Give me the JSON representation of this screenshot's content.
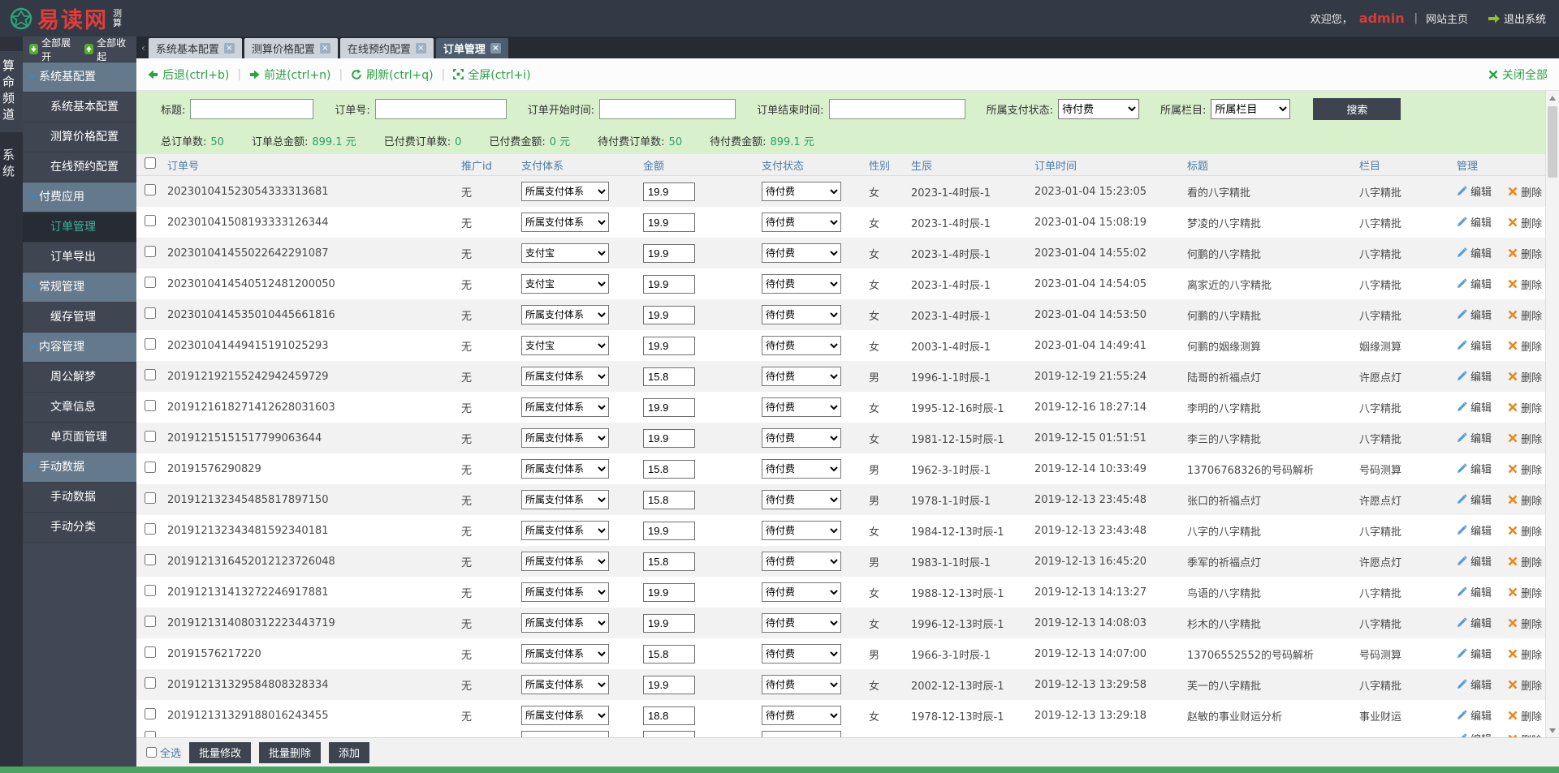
{
  "topbar": {
    "logo_text": "易读网",
    "logo_sub": "测算",
    "welcome_prefix": "欢迎您，",
    "username": "admin",
    "separator": "|",
    "home_link": "网站主页",
    "logout": "退出系统"
  },
  "rail": {
    "items": [
      {
        "label": "算命频道",
        "active": true
      },
      {
        "label": "系统",
        "active": false
      }
    ]
  },
  "sidebar": {
    "expand_all": "全部展开",
    "collapse_all": "全部收起",
    "groups": [
      {
        "label": "系统基配置",
        "items": [
          {
            "label": "系统基本配置",
            "active": false
          },
          {
            "label": "测算价格配置",
            "active": false
          },
          {
            "label": "在线预约配置",
            "active": false
          }
        ]
      },
      {
        "label": "付费应用",
        "items": [
          {
            "label": "订单管理",
            "active": true
          },
          {
            "label": "订单导出",
            "active": false
          }
        ]
      },
      {
        "label": "常规管理",
        "items": [
          {
            "label": "缓存管理",
            "active": false
          }
        ]
      },
      {
        "label": "内容管理",
        "items": [
          {
            "label": "周公解梦",
            "active": false
          },
          {
            "label": "文章信息",
            "active": false
          },
          {
            "label": "单页面管理",
            "active": false
          }
        ]
      },
      {
        "label": "手动数据",
        "items": [
          {
            "label": "手动数据",
            "active": false
          },
          {
            "label": "手动分类",
            "active": false
          }
        ]
      }
    ]
  },
  "tabs": [
    {
      "label": "系统基本配置",
      "active": false
    },
    {
      "label": "测算价格配置",
      "active": false
    },
    {
      "label": "在线预约配置",
      "active": false
    },
    {
      "label": "订单管理",
      "active": true
    }
  ],
  "toolbar": {
    "back": "后退(ctrl+b)",
    "forward": "前进(ctrl+n)",
    "refresh": "刷新(ctrl+q)",
    "fullscreen": "全屏(ctrl+i)",
    "close_all": "关闭全部",
    "separator": "|"
  },
  "filters": {
    "title_label": "标题:",
    "order_no_label": "订单号:",
    "start_time_label": "订单开始时间:",
    "end_time_label": "订单结束时间:",
    "pay_status_label": "所属支付状态:",
    "pay_status_value": "待付费",
    "category_label": "所属栏目:",
    "category_value": "所属栏目",
    "search_button": "搜索"
  },
  "summary": [
    {
      "label": "总订单数:",
      "value": "50"
    },
    {
      "label": "订单总金额:",
      "value": "899.1 元"
    },
    {
      "label": "已付费订单数:",
      "value": "0"
    },
    {
      "label": "已付费金额:",
      "value": "0 元"
    },
    {
      "label": "待付费订单数:",
      "value": "50"
    },
    {
      "label": "待付费金额:",
      "value": "899.1 元"
    }
  ],
  "table": {
    "headers": [
      "订单号",
      "推广id",
      "支付体系",
      "金额",
      "支付状态",
      "性别",
      "生辰",
      "订单时间",
      "标题",
      "栏目",
      "管理"
    ],
    "edit_label": "编辑",
    "delete_label": "删除",
    "rows": [
      {
        "order_no": "202301041523054333313681",
        "promo": "无",
        "pay_system": "所属支付体系",
        "amount": "19.9",
        "pay_status": "待付费",
        "gender": "女",
        "birth": "2023-1-4时辰-1",
        "order_time": "2023-01-04 15:23:05",
        "title": "看的八字精批",
        "category": "八字精批"
      },
      {
        "order_no": "202301041508193333126344",
        "promo": "无",
        "pay_system": "所属支付体系",
        "amount": "19.9",
        "pay_status": "待付费",
        "gender": "女",
        "birth": "2023-1-4时辰-1",
        "order_time": "2023-01-04 15:08:19",
        "title": "梦凌的八字精批",
        "category": "八字精批"
      },
      {
        "order_no": "202301041455022642291087",
        "promo": "无",
        "pay_system": "支付宝",
        "amount": "19.9",
        "pay_status": "待付费",
        "gender": "女",
        "birth": "2023-1-4时辰-1",
        "order_time": "2023-01-04 14:55:02",
        "title": "何鹏的八字精批",
        "category": "八字精批"
      },
      {
        "order_no": "2023010414540512481200050",
        "promo": "无",
        "pay_system": "支付宝",
        "amount": "19.9",
        "pay_status": "待付费",
        "gender": "女",
        "birth": "2023-1-4时辰-1",
        "order_time": "2023-01-04 14:54:05",
        "title": "离家近的八字精批",
        "category": "八字精批"
      },
      {
        "order_no": "2023010414535010445661816",
        "promo": "无",
        "pay_system": "所属支付体系",
        "amount": "19.9",
        "pay_status": "待付费",
        "gender": "女",
        "birth": "2023-1-4时辰-1",
        "order_time": "2023-01-04 14:53:50",
        "title": "何鹏的八字精批",
        "category": "八字精批"
      },
      {
        "order_no": "202301041449415191025293",
        "promo": "无",
        "pay_system": "支付宝",
        "amount": "19.9",
        "pay_status": "待付费",
        "gender": "女",
        "birth": "2003-1-4时辰-1",
        "order_time": "2023-01-04 14:49:41",
        "title": "何鹏的姻缘测算",
        "category": "姻缘测算"
      },
      {
        "order_no": "201912192155242942459729",
        "promo": "无",
        "pay_system": "所属支付体系",
        "amount": "15.8",
        "pay_status": "待付费",
        "gender": "男",
        "birth": "1996-1-1时辰-1",
        "order_time": "2019-12-19 21:55:24",
        "title": "陆哥的祈福点灯",
        "category": "许愿点灯"
      },
      {
        "order_no": "2019121618271412628031603",
        "promo": "无",
        "pay_system": "所属支付体系",
        "amount": "19.9",
        "pay_status": "待付费",
        "gender": "女",
        "birth": "1995-12-16时辰-1",
        "order_time": "2019-12-16 18:27:14",
        "title": "李明的八字精批",
        "category": "八字精批"
      },
      {
        "order_no": "20191215151517799063644",
        "promo": "无",
        "pay_system": "所属支付体系",
        "amount": "19.9",
        "pay_status": "待付费",
        "gender": "女",
        "birth": "1981-12-15时辰-1",
        "order_time": "2019-12-15 01:51:51",
        "title": "李三的八字精批",
        "category": "八字精批"
      },
      {
        "order_no": "20191576290829",
        "promo": "无",
        "pay_system": "所属支付体系",
        "amount": "15.8",
        "pay_status": "待付费",
        "gender": "男",
        "birth": "1962-3-1时辰-1",
        "order_time": "2019-12-14 10:33:49",
        "title": "13706768326的号码解析",
        "category": "号码测算"
      },
      {
        "order_no": "201912132345485817897150",
        "promo": "无",
        "pay_system": "所属支付体系",
        "amount": "15.8",
        "pay_status": "待付费",
        "gender": "男",
        "birth": "1978-1-1时辰-1",
        "order_time": "2019-12-13 23:45:48",
        "title": "张口的祈福点灯",
        "category": "许愿点灯"
      },
      {
        "order_no": "201912132343481592340181",
        "promo": "无",
        "pay_system": "所属支付体系",
        "amount": "19.9",
        "pay_status": "待付费",
        "gender": "女",
        "birth": "1984-12-13时辰-1",
        "order_time": "2019-12-13 23:43:48",
        "title": "八字的八字精批",
        "category": "八字精批"
      },
      {
        "order_no": "2019121316452012123726048",
        "promo": "无",
        "pay_system": "所属支付体系",
        "amount": "15.8",
        "pay_status": "待付费",
        "gender": "男",
        "birth": "1983-1-1时辰-1",
        "order_time": "2019-12-13 16:45:20",
        "title": "季军的祈福点灯",
        "category": "许愿点灯"
      },
      {
        "order_no": "201912131413272246917881",
        "promo": "无",
        "pay_system": "所属支付体系",
        "amount": "19.9",
        "pay_status": "待付费",
        "gender": "女",
        "birth": "1988-12-13时辰-1",
        "order_time": "2019-12-13 14:13:27",
        "title": "鸟语的八字精批",
        "category": "八字精批"
      },
      {
        "order_no": "2019121314080312223443719",
        "promo": "无",
        "pay_system": "所属支付体系",
        "amount": "19.9",
        "pay_status": "待付费",
        "gender": "女",
        "birth": "1996-12-13时辰-1",
        "order_time": "2019-12-13 14:08:03",
        "title": "杉木的八字精批",
        "category": "八字精批"
      },
      {
        "order_no": "20191576217220",
        "promo": "无",
        "pay_system": "所属支付体系",
        "amount": "15.8",
        "pay_status": "待付费",
        "gender": "男",
        "birth": "1966-3-1时辰-1",
        "order_time": "2019-12-13 14:07:00",
        "title": "13706552552的号码解析",
        "category": "号码测算"
      },
      {
        "order_no": "201912131329584808328334",
        "promo": "无",
        "pay_system": "所属支付体系",
        "amount": "19.9",
        "pay_status": "待付费",
        "gender": "女",
        "birth": "2002-12-13时辰-1",
        "order_time": "2019-12-13 13:29:58",
        "title": "芙一的八字精批",
        "category": "八字精批"
      },
      {
        "order_no": "201912131329188016243455",
        "promo": "无",
        "pay_system": "所属支付体系",
        "amount": "18.8",
        "pay_status": "待付费",
        "gender": "女",
        "birth": "1978-12-13时辰-1",
        "order_time": "2019-12-13 13:29:18",
        "title": "赵敏的事业财运分析",
        "category": "事业财运"
      },
      {
        "order_no": "",
        "promo": "",
        "pay_system": "",
        "amount": "",
        "pay_status": "",
        "gender": "",
        "birth": "",
        "order_time": "",
        "title": "",
        "category": "",
        "partial": true
      }
    ]
  },
  "footer": {
    "select_all": "全选",
    "batch_edit": "批量修改",
    "batch_delete": "批量删除",
    "add": "添加"
  },
  "colors": {
    "topbar_bg": "#343a45",
    "brand_red": "#e23b3b",
    "sidebar_bg": "#414754",
    "group_bg": "#64798b",
    "active_item_text": "#3eb29e",
    "link_green": "#2ba245",
    "filter_bg": "#d9f0cc",
    "summary_value": "#2e9e6b",
    "header_text": "#4d7ca8",
    "edit_icon_blue": "#5b9bd5",
    "delete_icon_orange": "#e8891c",
    "button_dark": "#3d4450",
    "bottom_strip_green": "#4aa565"
  }
}
